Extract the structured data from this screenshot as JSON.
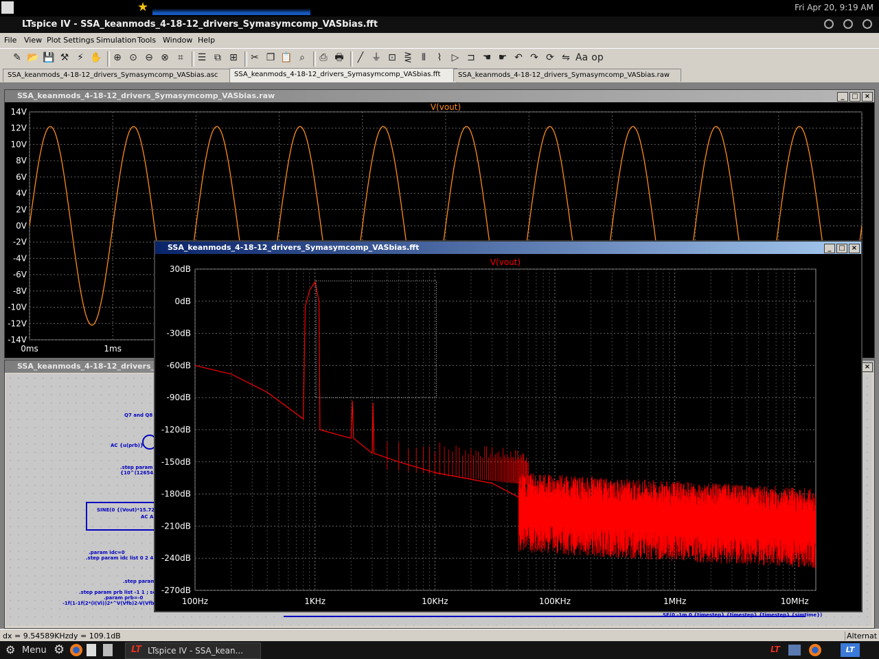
{
  "system": {
    "clock": "Fri Apr 20,  9:19 AM"
  },
  "app": {
    "title": "LTspice IV - SSA_keanmods_4-18-12_drivers_Symasymcomp_VASbias.fft"
  },
  "menu": [
    "File",
    "View",
    "Plot Settings",
    "Simulation",
    "Tools",
    "Window",
    "Help"
  ],
  "toolbar_icons": [
    "new-schematic-icon",
    "open-icon",
    "save-icon",
    "control-panel-icon",
    "run-icon",
    "halt-icon",
    "zoom-in-icon",
    "zoom-area-icon",
    "zoom-out-icon",
    "zoom-fit-icon",
    "autorange-icon",
    "tile-horizontal-icon",
    "cascade-icon",
    "tile-vertical-icon",
    "cut-icon",
    "copy-icon",
    "paste-icon",
    "find-icon",
    "print-preview-icon",
    "print-icon",
    "wire-icon",
    "ground-icon",
    "label-icon",
    "resistor-icon",
    "capacitor-icon",
    "inductor-icon",
    "diode-icon",
    "component-icon",
    "move-icon",
    "drag-icon",
    "undo-icon",
    "redo-icon",
    "rotate-icon",
    "mirror-icon",
    "text-icon",
    "spice-directive-icon"
  ],
  "tabs": [
    {
      "label": "SSA_keanmods_4-18-12_drivers_Symasymcomp_VASbias.asc"
    },
    {
      "label": "SSA_keanmods_4-18-12_drivers_Symasymcomp_VASbias.fft"
    },
    {
      "label": "SSA_keanmods_4-18-12_drivers_Symasymcomp_VASbias.raw"
    }
  ],
  "raw_window": {
    "title": "SSA_keanmods_4-18-12_drivers_Symasymcomp_VASbias.raw",
    "trace_label": "V(vout)",
    "color": "#ff8c1a"
  },
  "schematic_window": {
    "title": "SSA_keanmods_4-18-12_drivers_S",
    "texts": {
      "q7": "Q7 and Q8",
      "ac": "AC {u(prb)}",
      "step1": ".step param Vi",
      "step2": "{10^(12654.7k)}",
      "sine": "SINE(0 {(Vout)*15.72*",
      "aca": "AC A",
      "param1": ".param idc=0",
      "param2": ".step param idc list 0 2 4 6 8",
      "param3": ".step param",
      "param4": ".step param prb list -1 1 ; set p",
      "param5": ".param prb=-0",
      "param6": "-1f(1-1f(2*(I(Vi))2*^V(Vfb)2-V(Vfb))",
      "tran": "SE(0 -1m 0 {timestep} {timestep} {timestep} {simtime})"
    }
  },
  "fft_window": {
    "title": "SSA_keanmods_4-18-12_drivers_Symasymcomp_VASbias.fft",
    "trace_label": "V(vout)",
    "color": "#ff0000"
  },
  "status": {
    "dx": "dx = 9.54589KHz",
    "dy": "dy = 109.1dB",
    "right": "Alternat"
  },
  "taskbar": {
    "menu": "Menu",
    "task": "LTspice IV - SSA_kean..."
  },
  "chart_data": [
    {
      "type": "line",
      "title": "V(vout)",
      "xlabel": "",
      "ylabel": "",
      "x_ticks": [
        "0ms",
        "1ms"
      ],
      "y_ticks": [
        "14V",
        "12V",
        "10V",
        "8V",
        "6V",
        "4V",
        "2V",
        "0V",
        "-2V",
        "-4V",
        "-6V",
        "-8V",
        "-10V",
        "-12V",
        "-14V"
      ],
      "ylim": [
        -14,
        14
      ],
      "xlim_ms": [
        0,
        10
      ],
      "series": [
        {
          "name": "V(vout)",
          "amplitude_V": 12.2,
          "frequency_Hz": 1000,
          "phase": "sin"
        }
      ],
      "grid": true
    },
    {
      "type": "line",
      "title": "V(vout)",
      "xlabel": "",
      "ylabel": "",
      "x_scale": "log",
      "x_ticks": [
        "100Hz",
        "1KHz",
        "10KHz",
        "100KHz",
        "1MHz",
        "10MHz"
      ],
      "y_ticks": [
        "30dB",
        "0dB",
        "-30dB",
        "-60dB",
        "-90dB",
        "-120dB",
        "-150dB",
        "-180dB",
        "-210dB",
        "-240dB",
        "-270dB"
      ],
      "ylim": [
        -270,
        30
      ],
      "xlim_Hz": [
        100,
        15000000
      ],
      "series": [
        {
          "name": "V(vout)",
          "points_Hz_dB": [
            [
              100,
              -60
            ],
            [
              200,
              -68
            ],
            [
              400,
              -85
            ],
            [
              800,
              -110
            ],
            [
              830,
              -5
            ],
            [
              900,
              10
            ],
            [
              1000,
              18
            ],
            [
              1080,
              0
            ],
            [
              1100,
              -120
            ],
            [
              2000,
              -128
            ],
            [
              2050,
              -93
            ],
            [
              2100,
              -128
            ],
            [
              3000,
              -142
            ],
            [
              3050,
              -95
            ],
            [
              3100,
              -142
            ],
            [
              5000,
              -150
            ],
            [
              10000,
              -160
            ],
            [
              30000,
              -170
            ],
            [
              80000,
              -195
            ],
            [
              100000,
              -200
            ],
            [
              1000000,
              -210
            ],
            [
              10000000,
              -220
            ]
          ]
        }
      ],
      "grid": true
    }
  ]
}
